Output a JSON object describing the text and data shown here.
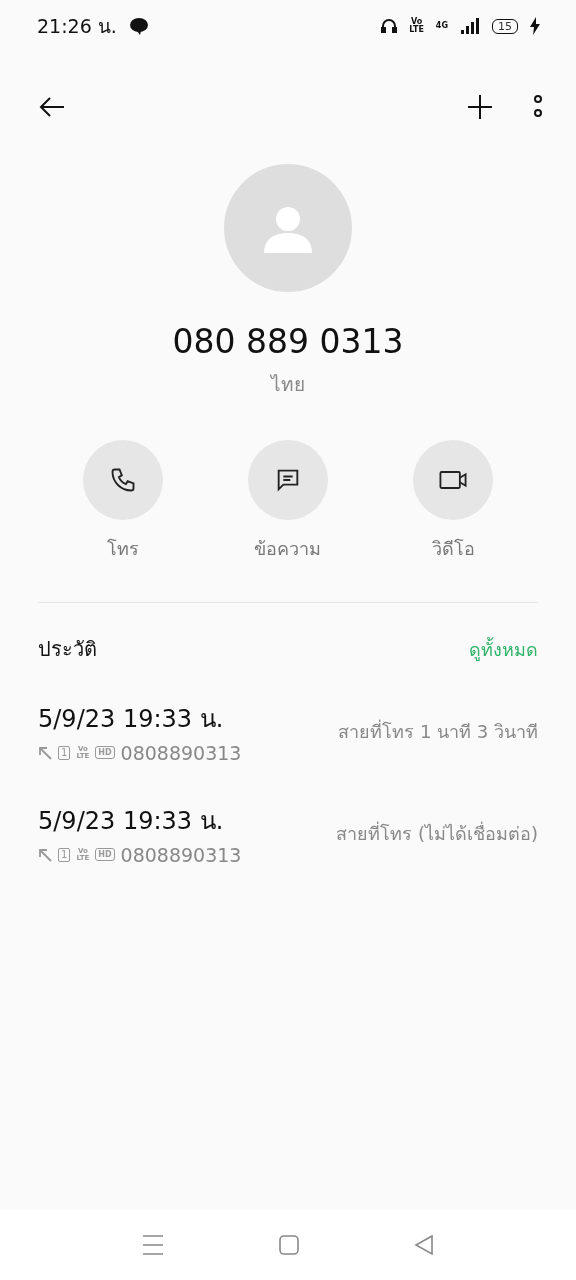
{
  "status_bar": {
    "time": "21:26 น.",
    "volte_top": "Vo",
    "volte_bottom": "LTE",
    "network": "4G",
    "battery": "15",
    "charging": true
  },
  "contact": {
    "number": "080 889 0313",
    "region": "ไทย"
  },
  "actions": [
    {
      "kind": "call",
      "label": "โทร"
    },
    {
      "kind": "message",
      "label": "ข้อความ"
    },
    {
      "kind": "video",
      "label": "วิดีโอ"
    }
  ],
  "history": {
    "title": "ประวัติ",
    "view_all": "ดูทั้งหมด",
    "entries": [
      {
        "datetime": "5/9/23 19:33 น.",
        "sim": "1",
        "volte_top": "Vo",
        "volte_bottom": "LTE",
        "hd": "HD",
        "number": "0808890313",
        "status": "สายที่โทร  1 นาที 3 วินาที"
      },
      {
        "datetime": "5/9/23 19:33 น.",
        "sim": "1",
        "volte_top": "Vo",
        "volte_bottom": "LTE",
        "hd": "HD",
        "number": "0808890313",
        "status": "สายที่โทร (ไม่ได้เชื่อมต่อ)"
      }
    ]
  }
}
